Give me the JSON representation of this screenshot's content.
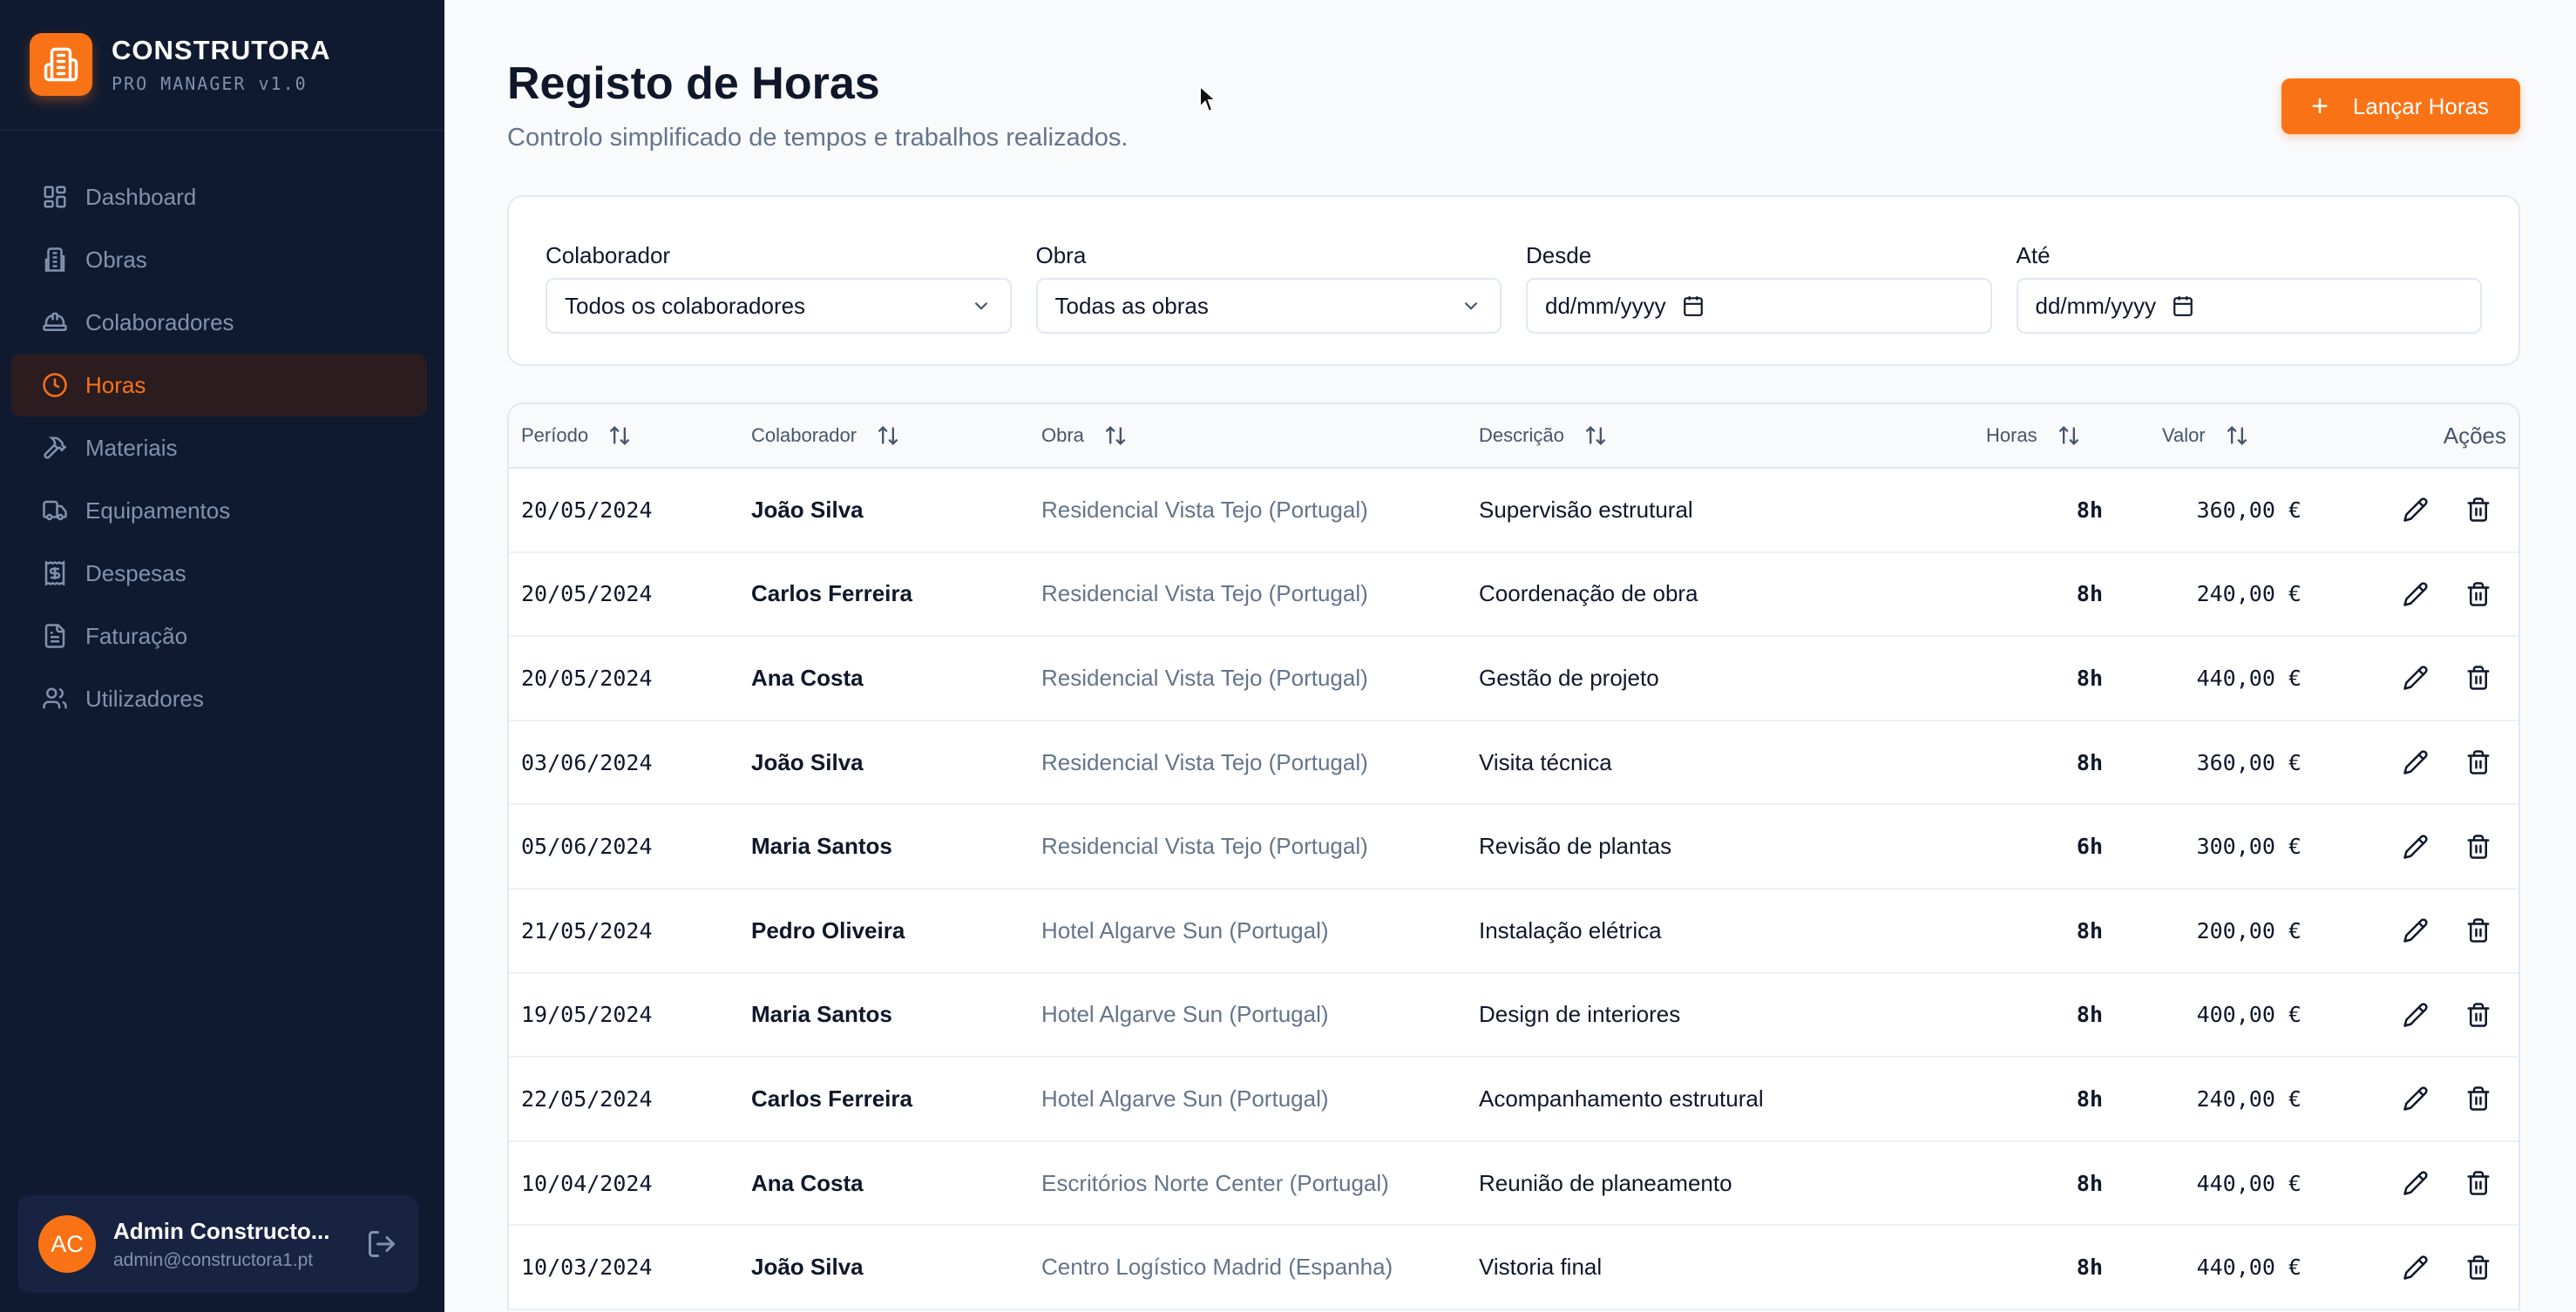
{
  "brand": {
    "title": "CONSTRUTORA",
    "subtitle": "PRO MANAGER v1.0",
    "accent": "#f97316"
  },
  "sidebar": {
    "items": [
      {
        "label": "Dashboard",
        "icon": "dashboard-icon",
        "active": false
      },
      {
        "label": "Obras",
        "icon": "building-icon",
        "active": false
      },
      {
        "label": "Colaboradores",
        "icon": "hardhat-icon",
        "active": false
      },
      {
        "label": "Horas",
        "icon": "clock-icon",
        "active": true
      },
      {
        "label": "Materiais",
        "icon": "hammer-icon",
        "active": false
      },
      {
        "label": "Equipamentos",
        "icon": "truck-icon",
        "active": false
      },
      {
        "label": "Despesas",
        "icon": "receipt-icon",
        "active": false
      },
      {
        "label": "Faturação",
        "icon": "document-icon",
        "active": false
      },
      {
        "label": "Utilizadores",
        "icon": "users-icon",
        "active": false
      }
    ]
  },
  "user": {
    "initials": "AC",
    "name": "Admin Constructo...",
    "email": "admin@constructora1.pt"
  },
  "header": {
    "title": "Registo de Horas",
    "subtitle": "Controlo simplificado de tempos e trabalhos realizados.",
    "add_button": "Lançar Horas"
  },
  "filters": {
    "colaborador": {
      "label": "Colaborador",
      "value": "Todos os colaboradores"
    },
    "obra": {
      "label": "Obra",
      "value": "Todas as obras"
    },
    "desde": {
      "label": "Desde",
      "value": "dd/mm/yyyy"
    },
    "ate": {
      "label": "Até",
      "value": "dd/mm/yyyy"
    }
  },
  "table": {
    "columns": {
      "periodo": "Período",
      "colaborador": "Colaborador",
      "obra": "Obra",
      "descricao": "Descrição",
      "horas": "Horas",
      "valor": "Valor",
      "acoes": "Ações"
    },
    "rows": [
      {
        "periodo": "20/05/2024",
        "colaborador": "João Silva",
        "obra": "Residencial Vista Tejo (Portugal)",
        "descricao": "Supervisão estrutural",
        "horas": "8h",
        "valor": "360,00 €"
      },
      {
        "periodo": "20/05/2024",
        "colaborador": "Carlos Ferreira",
        "obra": "Residencial Vista Tejo (Portugal)",
        "descricao": "Coordenação de obra",
        "horas": "8h",
        "valor": "240,00 €"
      },
      {
        "periodo": "20/05/2024",
        "colaborador": "Ana Costa",
        "obra": "Residencial Vista Tejo (Portugal)",
        "descricao": "Gestão de projeto",
        "horas": "8h",
        "valor": "440,00 €"
      },
      {
        "periodo": "03/06/2024",
        "colaborador": "João Silva",
        "obra": "Residencial Vista Tejo (Portugal)",
        "descricao": "Visita técnica",
        "horas": "8h",
        "valor": "360,00 €"
      },
      {
        "periodo": "05/06/2024",
        "colaborador": "Maria Santos",
        "obra": "Residencial Vista Tejo (Portugal)",
        "descricao": "Revisão de plantas",
        "horas": "6h",
        "valor": "300,00 €"
      },
      {
        "periodo": "21/05/2024",
        "colaborador": "Pedro Oliveira",
        "obra": "Hotel Algarve Sun (Portugal)",
        "descricao": "Instalação elétrica",
        "horas": "8h",
        "valor": "200,00 €"
      },
      {
        "periodo": "19/05/2024",
        "colaborador": "Maria Santos",
        "obra": "Hotel Algarve Sun (Portugal)",
        "descricao": "Design de interiores",
        "horas": "8h",
        "valor": "400,00 €"
      },
      {
        "periodo": "22/05/2024",
        "colaborador": "Carlos Ferreira",
        "obra": "Hotel Algarve Sun (Portugal)",
        "descricao": "Acompanhamento estrutural",
        "horas": "8h",
        "valor": "240,00 €"
      },
      {
        "periodo": "10/04/2024",
        "colaborador": "Ana Costa",
        "obra": "Escritórios Norte Center (Portugal)",
        "descricao": "Reunião de planeamento",
        "horas": "8h",
        "valor": "440,00 €"
      },
      {
        "periodo": "10/03/2024",
        "colaborador": "João Silva",
        "obra": "Centro Logístico Madrid (Espanha)",
        "descricao": "Vistoria final",
        "horas": "8h",
        "valor": "440,00 €"
      }
    ]
  }
}
